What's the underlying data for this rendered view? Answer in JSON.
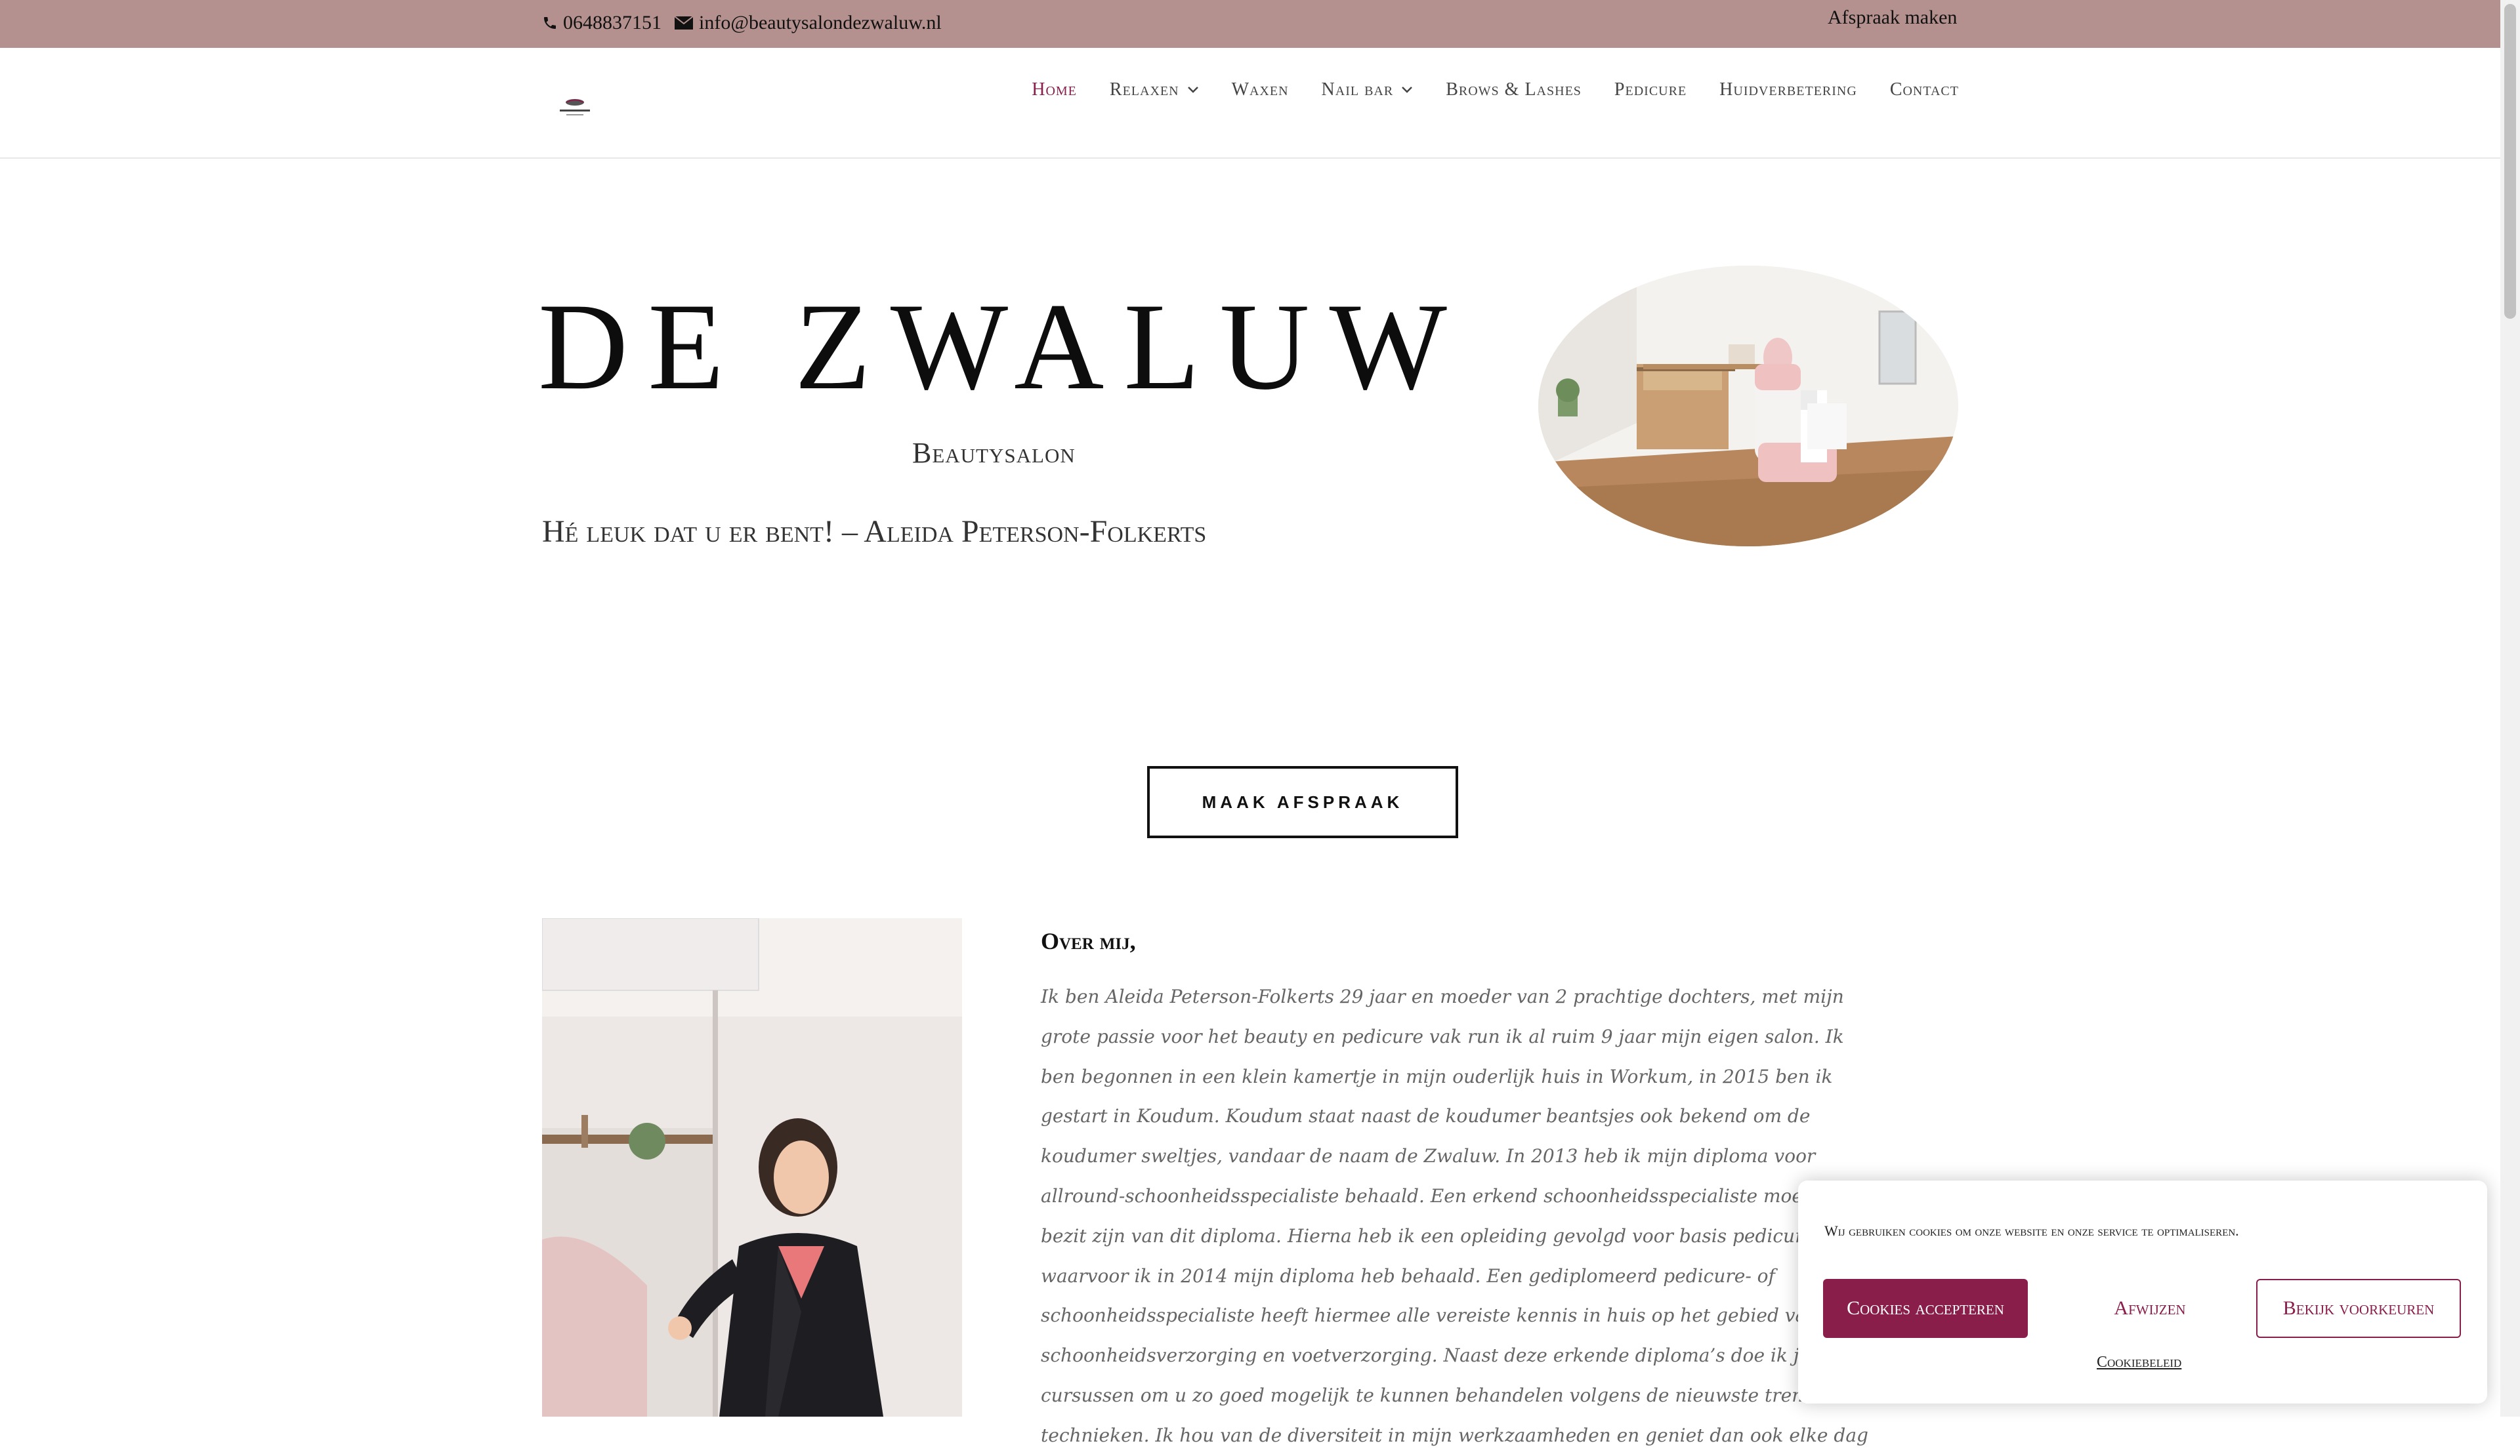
{
  "topbar": {
    "phone": "0648837151",
    "email": "info@beautysalondezwaluw.nl",
    "appointment": "Afspraak maken",
    "background": "#b4918e"
  },
  "nav": {
    "items": [
      {
        "label": "Home",
        "active": true
      },
      {
        "label": "Relaxen",
        "dropdown": true
      },
      {
        "label": "Waxen"
      },
      {
        "label": "Nail bar",
        "dropdown": true
      },
      {
        "label": "Brows & Lashes"
      },
      {
        "label": "Pedicure"
      },
      {
        "label": "Huidverbetering"
      },
      {
        "label": "Contact"
      }
    ]
  },
  "hero": {
    "title": "DE ZWALUW",
    "subtitle": "Beautysalon",
    "greeting": "Hé leuk dat u er bent! – Aleida Peterson-Folkerts"
  },
  "cta": {
    "label": "MAAK AFSPRAAK"
  },
  "about": {
    "heading": "Over mij,",
    "text": "Ik ben Aleida Peterson-Folkerts 29 jaar en moeder van 2 prachtige dochters, met mijn grote passie voor het beauty en pedicure vak run ik al ruim 9 jaar mijn eigen salon. Ik ben begonnen in een klein kamertje in mijn ouderlijk huis in Workum, in 2015 ben ik gestart in Koudum. Koudum staat naast de koudumer beantsjes ook bekend om de koudumer sweltjes, vandaar de naam de Zwaluw. In 2013 heb ik mijn diploma voor allround-schoonheidsspecialiste behaald. Een erkend schoonheidsspecialiste moet in het bezit zijn van dit diploma. Hierna heb ik een opleiding gevolgd voor basis pedicure, waarvoor ik in 2014 mijn diploma heb behaald. Een gediplomeerd pedicure- of schoonheidsspecialiste heeft hiermee alle vereiste kennis in huis op het gebied van schoonheidsverzorging en voetverzorging. Naast deze erkende diploma’s doe ik jaarlijks cursussen om u zo goed mogelijk te kunnen behandelen volgens de nieuwste trends en technieken. Ik hou van de diversiteit in mijn werkzaamheden en geniet dan ook elke dag"
  },
  "cookie": {
    "message": "Wij gebruiken cookies om onze website en onze service te optimaliseren.",
    "accept": "Cookies accepteren",
    "deny": "Afwijzen",
    "preferences": "Bekijk voorkeuren",
    "policy": "Cookiebeleid",
    "accent": "#8a1e4b"
  }
}
